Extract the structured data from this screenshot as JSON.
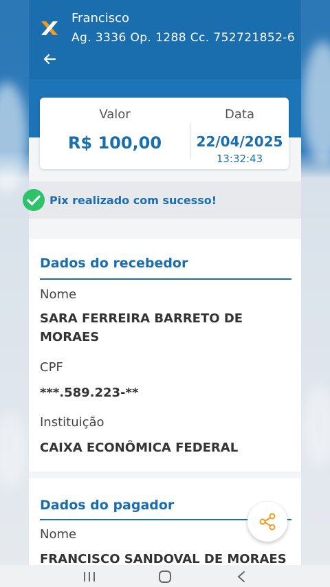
{
  "account": {
    "name": "Francisco",
    "details": "Ag. 3336 Op. 1288 Cc. 752721852-6"
  },
  "summary": {
    "value_label": "Valor",
    "value": "R$ 100,00",
    "date_label": "Data",
    "date": "22/04/2025",
    "time": "13:32:43"
  },
  "status": {
    "message": "Pix realizado com sucesso!"
  },
  "receiver": {
    "title": "Dados do recebedor",
    "name_label": "Nome",
    "name": "SARA FERREIRA BARRETO DE MORAES",
    "cpf_label": "CPF",
    "cpf": "***.589.223-**",
    "institution_label": "Instituição",
    "institution": "CAIXA ECONÔMICA FEDERAL"
  },
  "payer": {
    "title": "Dados do pagador",
    "name_label": "Nome",
    "name": "FRANCISCO SANDOVAL DE MORAES"
  },
  "colors": {
    "brand_blue": "#1b6eae",
    "success_green": "#2fc26b",
    "share_orange": "#f39a1c"
  },
  "icons": {
    "logo": "caixa-x-logo",
    "back": "arrow-left-icon",
    "success": "check-circle-icon",
    "share": "share-icon"
  }
}
